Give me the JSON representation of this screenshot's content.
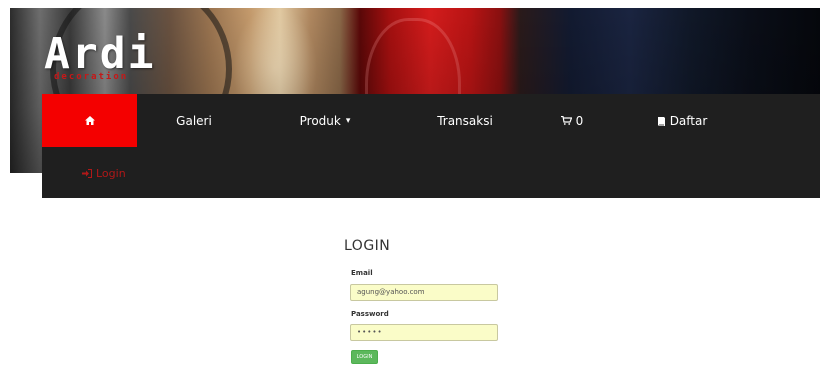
{
  "header": {
    "logo_text": "Ardi",
    "logo_subtext": "decoration"
  },
  "navbar": {
    "home_icon": "home-icon",
    "items": [
      {
        "label": "Galeri"
      },
      {
        "label": "Produk",
        "icon": "caret-down-icon"
      },
      {
        "label": "Transaksi"
      },
      {
        "label": "0",
        "icon": "cart-icon"
      },
      {
        "label": "Daftar",
        "icon": "book-icon"
      }
    ],
    "login": {
      "label": "Login",
      "icon": "sign-in-icon"
    }
  },
  "login_form": {
    "title": "LOGIN",
    "email_label": "Email",
    "email_value": "agung@yahoo.com",
    "password_label": "Password",
    "password_value": "•••••",
    "submit_label": "LOGIN"
  },
  "colors": {
    "nav_background": "#1f1f1f",
    "nav_active": "#f40000",
    "login_link": "#b01818",
    "input_background": "#fafcc8",
    "button": "#5cb85c"
  }
}
